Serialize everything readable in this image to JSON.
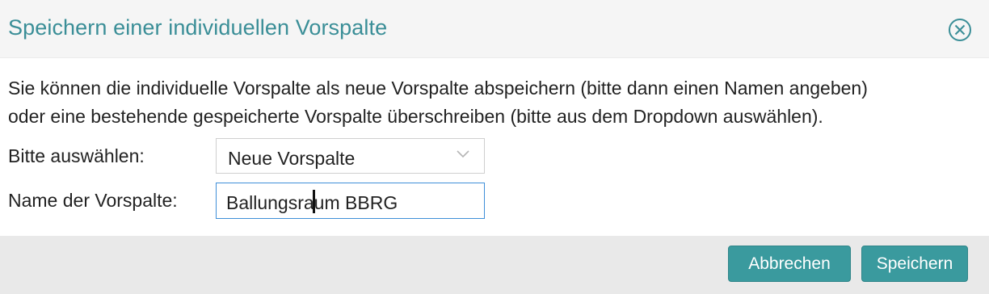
{
  "dialog": {
    "title": "Speichern einer individuellen Vorspalte",
    "close_icon": "close-circle-icon",
    "description_line1": "Sie können die individuelle Vorspalte als neue Vorspalte abspeichern (bitte dann einen Namen angeben)",
    "description_line2": "oder eine bestehende gespeicherte Vorspalte überschreiben (bitte aus dem Dropdown auswählen).",
    "select": {
      "label": "Bitte auswählen:",
      "value": "Neue Vorspalte",
      "icon": "chevron-down-icon"
    },
    "name_field": {
      "label": "Name der Vorspalte:",
      "value_before_caret": "Ballungsr",
      "value_after_caret": "aum BBRG"
    },
    "buttons": {
      "cancel": "Abbrechen",
      "save": "Speichern"
    },
    "colors": {
      "accent": "#3a8e97",
      "button": "#3a9a9e",
      "input_focus": "#3f8fd8"
    }
  }
}
